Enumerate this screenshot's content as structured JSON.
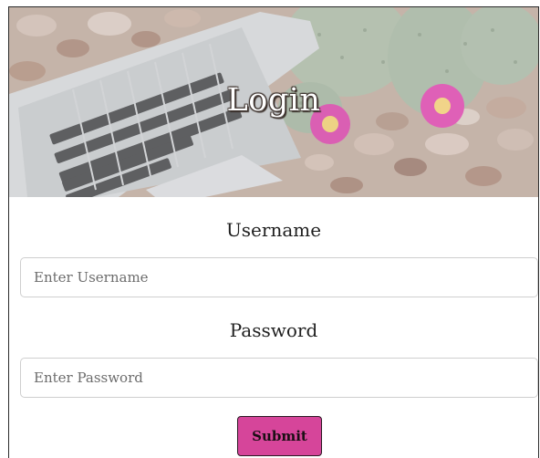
{
  "hero": {
    "title": "Login"
  },
  "form": {
    "username": {
      "label": "Username",
      "placeholder": "Enter Username"
    },
    "password": {
      "label": "Password",
      "placeholder": "Enter Password"
    },
    "submit_label": "Submit"
  },
  "colors": {
    "submit_background": "#d6459a",
    "frame_border": "#2a2a2a"
  }
}
